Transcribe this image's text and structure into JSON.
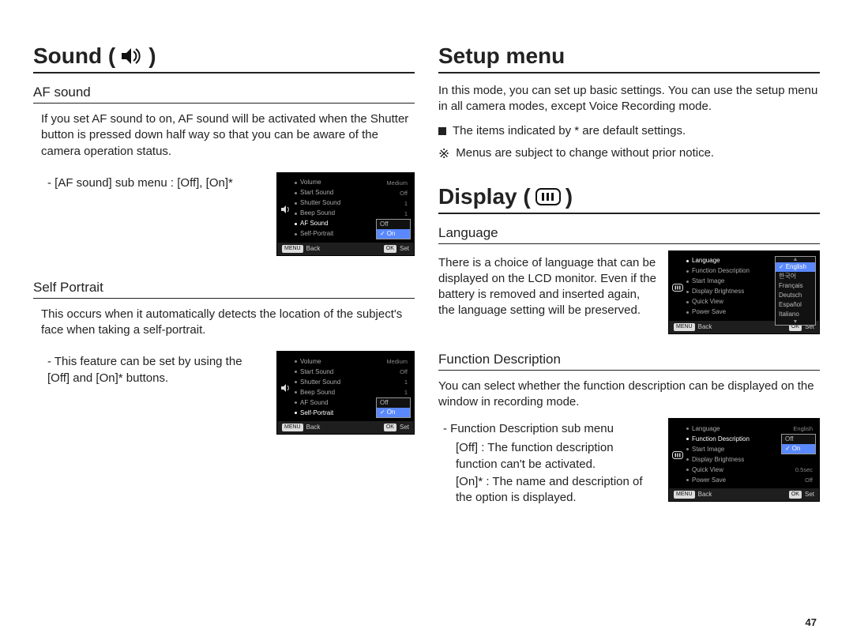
{
  "page_number": "47",
  "left": {
    "heading": "Sound (",
    "heading_close": ")",
    "af_sound": {
      "title": "AF sound",
      "body": "If you set AF sound to on, AF sound will be activated when the Shutter button is pressed down half way so that you can be aware of the camera operation status.",
      "sub": "- [AF sound] sub menu : [Off], [On]*",
      "shot": {
        "rows": [
          {
            "label": "Volume",
            "value": "Medium"
          },
          {
            "label": "Start Sound",
            "value": "Off"
          },
          {
            "label": "Shutter Sound",
            "value": "1"
          },
          {
            "label": "Beep Sound",
            "value": "1"
          },
          {
            "label": "AF Sound",
            "value": "",
            "active": true
          },
          {
            "label": "Self-Portrait",
            "value": ""
          }
        ],
        "popup": {
          "options": [
            "Off",
            "On"
          ],
          "selected": "On"
        },
        "footer": {
          "back": "Back",
          "set": "Set",
          "back_key": "MENU",
          "set_key": "OK"
        }
      }
    },
    "self_portrait": {
      "title": "Self Portrait",
      "body": "This occurs when it automatically detects the location of the subject's face when taking a self-portrait.",
      "sub": "- This feature can be set by using the [Off] and [On]* buttons.",
      "shot": {
        "rows": [
          {
            "label": "Volume",
            "value": "Medium"
          },
          {
            "label": "Start Sound",
            "value": "Off"
          },
          {
            "label": "Shutter Sound",
            "value": "1"
          },
          {
            "label": "Beep Sound",
            "value": "1"
          },
          {
            "label": "AF Sound",
            "value": ""
          },
          {
            "label": "Self-Portrait",
            "value": "",
            "active": true
          }
        ],
        "popup": {
          "options": [
            "Off",
            "On"
          ],
          "selected": "On"
        },
        "footer": {
          "back": "Back",
          "set": "Set",
          "back_key": "MENU",
          "set_key": "OK"
        }
      }
    }
  },
  "right": {
    "setup": {
      "heading": "Setup menu",
      "body": "In this mode, you can set up basic settings. You can use the setup menu in all camera modes, except Voice Recording mode.",
      "bullet": "The items indicated by * are default settings.",
      "note_marker": "※",
      "note": "Menus are subject to change without prior notice."
    },
    "display": {
      "heading": "Display (",
      "heading_close": ")",
      "language": {
        "title": "Language",
        "body": "There is a choice of language that can be displayed on the LCD monitor. Even if the battery is removed and inserted again, the language setting will be preserved.",
        "shot": {
          "rows": [
            {
              "label": "Language",
              "value": "",
              "active": true
            },
            {
              "label": "Function Description",
              "value": ""
            },
            {
              "label": "Start Image",
              "value": ""
            },
            {
              "label": "Display Brightness",
              "value": ""
            },
            {
              "label": "Quick View",
              "value": ""
            },
            {
              "label": "Power Save",
              "value": ""
            }
          ],
          "popup": {
            "options": [
              "English",
              "한국어",
              "Français",
              "Deutsch",
              "Español",
              "Italiano"
            ],
            "selected": "English",
            "scroll": true
          },
          "footer": {
            "back": "Back",
            "set": "Set",
            "back_key": "MENU",
            "set_key": "OK"
          }
        }
      },
      "func_desc": {
        "title": "Function Description",
        "body": "You can select whether the function description can be displayed on the window in recording mode.",
        "sub": "- Function Description sub menu",
        "opt_off": "[Off] : The function description function can't be activated.",
        "opt_on": "[On]* : The name and description of the option is displayed.",
        "shot": {
          "rows": [
            {
              "label": "Language",
              "value": "English"
            },
            {
              "label": "Function Description",
              "value": "",
              "active": true
            },
            {
              "label": "Start Image",
              "value": ""
            },
            {
              "label": "Display Brightness",
              "value": ""
            },
            {
              "label": "Quick View",
              "value": "0.5sec"
            },
            {
              "label": "Power Save",
              "value": "Off"
            }
          ],
          "popup": {
            "options": [
              "Off",
              "On"
            ],
            "selected": "On"
          },
          "footer": {
            "back": "Back",
            "set": "Set",
            "back_key": "MENU",
            "set_key": "OK"
          }
        }
      }
    }
  }
}
